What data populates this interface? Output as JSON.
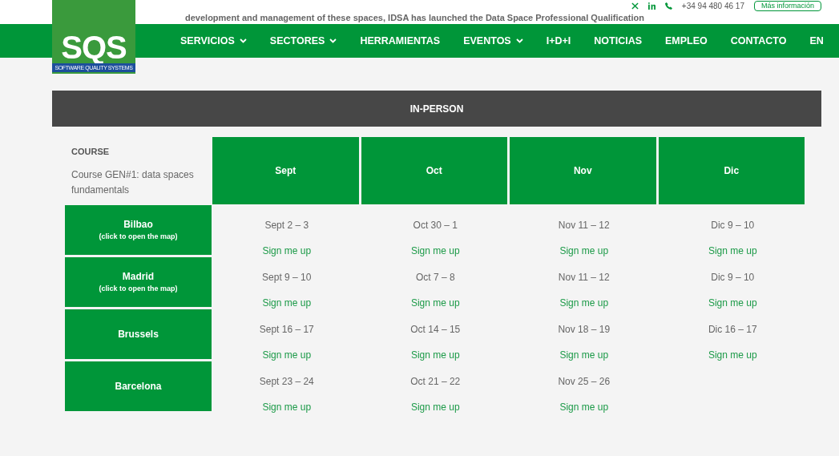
{
  "top_bar": {
    "phone": "+34 94 480 46 17",
    "info_button": "Más información",
    "intro_text": "development and management of these spaces, IDSA has launched the Data Space Professional Qualification"
  },
  "logo": {
    "letters": "SQS",
    "tagline": "SOFTWARE QUALITY SYSTEMS"
  },
  "nav": [
    {
      "label": "SERVICIOS",
      "dropdown": true
    },
    {
      "label": "SECTORES",
      "dropdown": true
    },
    {
      "label": "HERRAMIENTAS",
      "dropdown": false
    },
    {
      "label": "EVENTOS",
      "dropdown": true
    },
    {
      "label": "I+D+I",
      "dropdown": false
    },
    {
      "label": "NOTICIAS",
      "dropdown": false
    },
    {
      "label": "EMPLEO",
      "dropdown": false
    },
    {
      "label": "CONTACTO",
      "dropdown": false
    },
    {
      "label": "EN",
      "dropdown": false
    }
  ],
  "table": {
    "title": "IN-PERSON",
    "course_label": "COURSE",
    "course_name": "Course GEN#1: data spaces fundamentals",
    "months": [
      "Sept",
      "Oct",
      "Nov",
      "Dic"
    ],
    "rows": [
      {
        "city": "Bilbao",
        "note": "(click to open the map)",
        "cells": [
          {
            "date": "Sept 2 – 3",
            "link": "Sign me up"
          },
          {
            "date": "Oct 30 – 1",
            "link": "Sign me up"
          },
          {
            "date": "Nov 11 – 12",
            "link": "Sign me up"
          },
          {
            "date": "Dic 9 – 10",
            "link": "Sign me up"
          }
        ]
      },
      {
        "city": "Madrid",
        "note": "(click to open the map)",
        "cells": [
          {
            "date": "Sept 9 – 10",
            "link": "Sign me up"
          },
          {
            "date": "Oct 7 – 8",
            "link": "Sign me up"
          },
          {
            "date": "Nov 11 – 12",
            "link": "Sign me up"
          },
          {
            "date": "Dic 9 – 10",
            "link": "Sign me up"
          }
        ]
      },
      {
        "city": "Brussels",
        "cells": [
          {
            "date": "Sept 16 – 17",
            "link": "Sign me up"
          },
          {
            "date": "Oct 14 – 15",
            "link": "Sign me up"
          },
          {
            "date": "Nov 18 – 19",
            "link": "Sign me up"
          },
          {
            "date": "Dic 16 – 17",
            "link": "Sign me up"
          }
        ]
      },
      {
        "city": "Barcelona",
        "cells": [
          {
            "date": "Sept 23 – 24",
            "link": "Sign me up"
          },
          {
            "date": "Oct 21 – 22",
            "link": "Sign me up"
          },
          {
            "date": "Nov 25 – 26",
            "link": "Sign me up"
          }
        ]
      }
    ]
  }
}
